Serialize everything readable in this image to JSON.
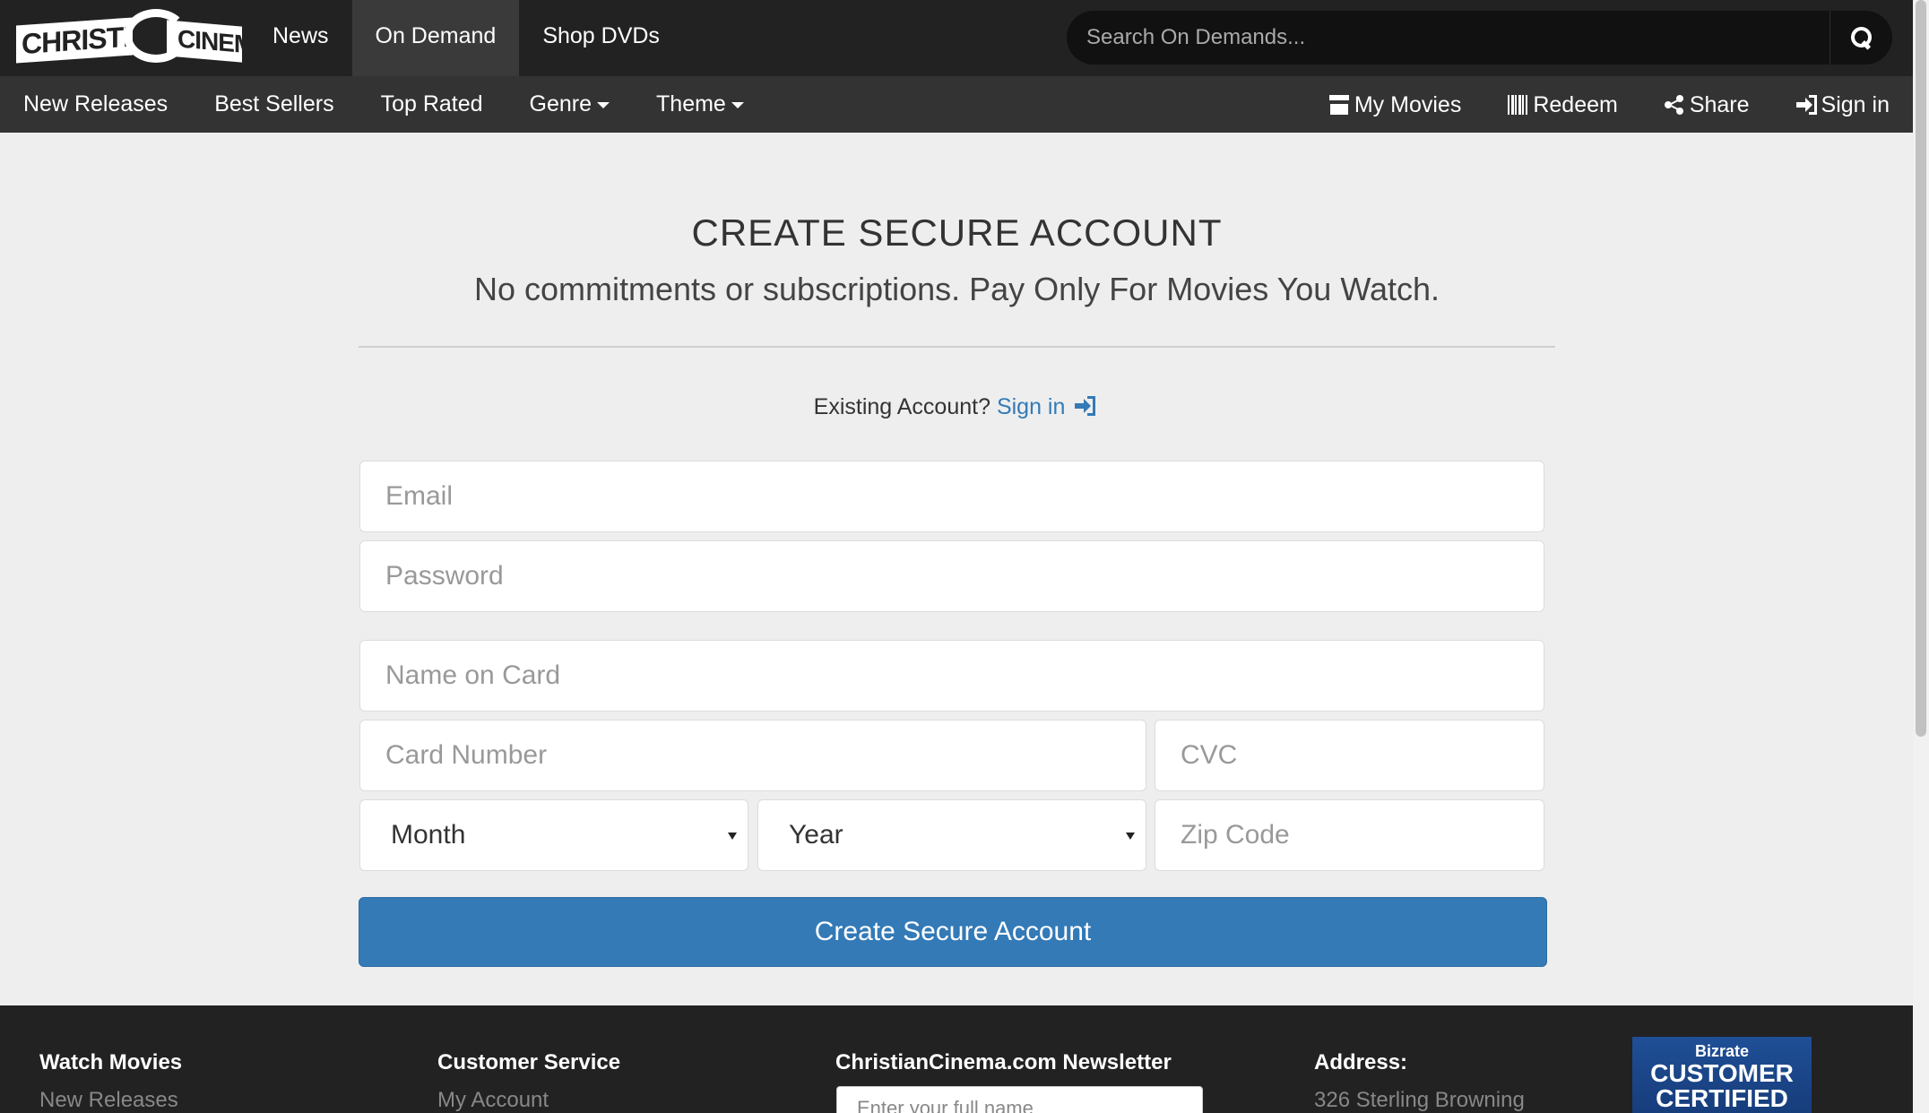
{
  "brand": {
    "logo_text": "CHRISTIAN CINEMA"
  },
  "top_nav": [
    {
      "label": "News",
      "active": false
    },
    {
      "label": "On Demand",
      "active": true
    },
    {
      "label": "Shop DVDs",
      "active": false
    }
  ],
  "search": {
    "placeholder": "Search On Demands...",
    "icon": "search-icon"
  },
  "sub_nav": [
    {
      "label": "New Releases"
    },
    {
      "label": "Best Sellers"
    },
    {
      "label": "Top Rated"
    },
    {
      "label": "Genre",
      "dropdown": true
    },
    {
      "label": "Theme",
      "dropdown": true
    }
  ],
  "account_nav": [
    {
      "label": "My Movies",
      "icon": "archive-icon"
    },
    {
      "label": "Redeem",
      "icon": "barcode-icon"
    },
    {
      "label": "Share",
      "icon": "share-icon"
    },
    {
      "label": "Sign in",
      "icon": "sign-in-icon"
    }
  ],
  "form": {
    "title": "CREATE SECURE ACCOUNT",
    "subtitle": "No commitments or subscriptions. Pay Only For Movies You Watch.",
    "existing_text": "Existing Account?",
    "signin_link": "Sign in",
    "email_placeholder": "Email",
    "password_placeholder": "Password",
    "name_placeholder": "Name on Card",
    "card_placeholder": "Card Number",
    "cvc_placeholder": "CVC",
    "month_value": "Month",
    "year_value": "Year",
    "zip_placeholder": "Zip Code",
    "submit_label": "Create Secure Account"
  },
  "footer": {
    "watch_heading": "Watch Movies",
    "watch_link": "New Releases",
    "service_heading": "Customer Service",
    "service_link": "My Account",
    "newsletter_heading": "ChristianCinema.com Newsletter",
    "newsletter_placeholder": "Enter your full name",
    "address_heading": "Address:",
    "address_line": "326 Sterling Browning",
    "badge_top": "Bizrate",
    "badge_line1": "CUSTOMER",
    "badge_line2": "CERTIFIED"
  },
  "colors": {
    "topbar": "#222222",
    "subbar": "#333333",
    "page_bg": "#eeeeee",
    "accent": "#337ab7"
  }
}
